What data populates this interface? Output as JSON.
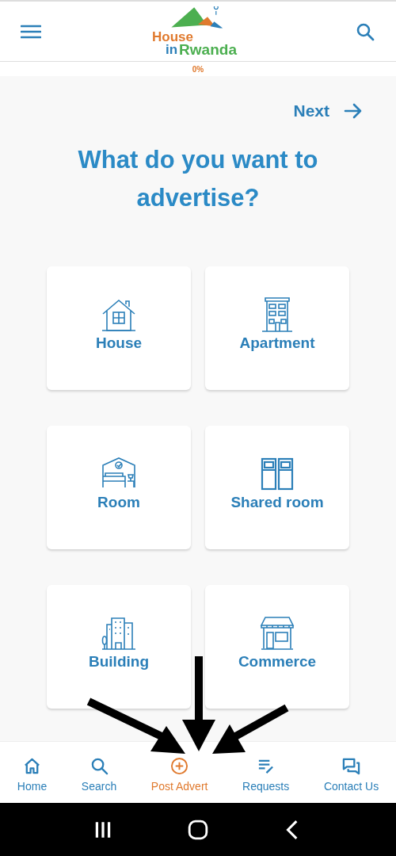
{
  "header": {
    "logo": {
      "line1": "House",
      "line2_a": "in",
      "line2_b": "Rwanda"
    }
  },
  "progress": {
    "label": "0%",
    "level": 0
  },
  "next": {
    "label": "Next"
  },
  "title": "What do you want to advertise?",
  "options": [
    {
      "kind": "house",
      "label": "House"
    },
    {
      "kind": "apartment",
      "label": "Apartment"
    },
    {
      "kind": "room",
      "label": "Room"
    },
    {
      "kind": "shared_room",
      "label": "Shared room"
    },
    {
      "kind": "building",
      "label": "Building"
    },
    {
      "kind": "commerce",
      "label": "Commerce"
    }
  ],
  "bottom_nav": [
    {
      "kind": "home",
      "label": "Home",
      "selected": false
    },
    {
      "kind": "search",
      "label": "Search",
      "selected": false
    },
    {
      "kind": "post",
      "label": "Post Advert",
      "selected": true
    },
    {
      "kind": "requests",
      "label": "Requests",
      "selected": false
    },
    {
      "kind": "contact",
      "label": "Contact Us",
      "selected": false
    }
  ]
}
